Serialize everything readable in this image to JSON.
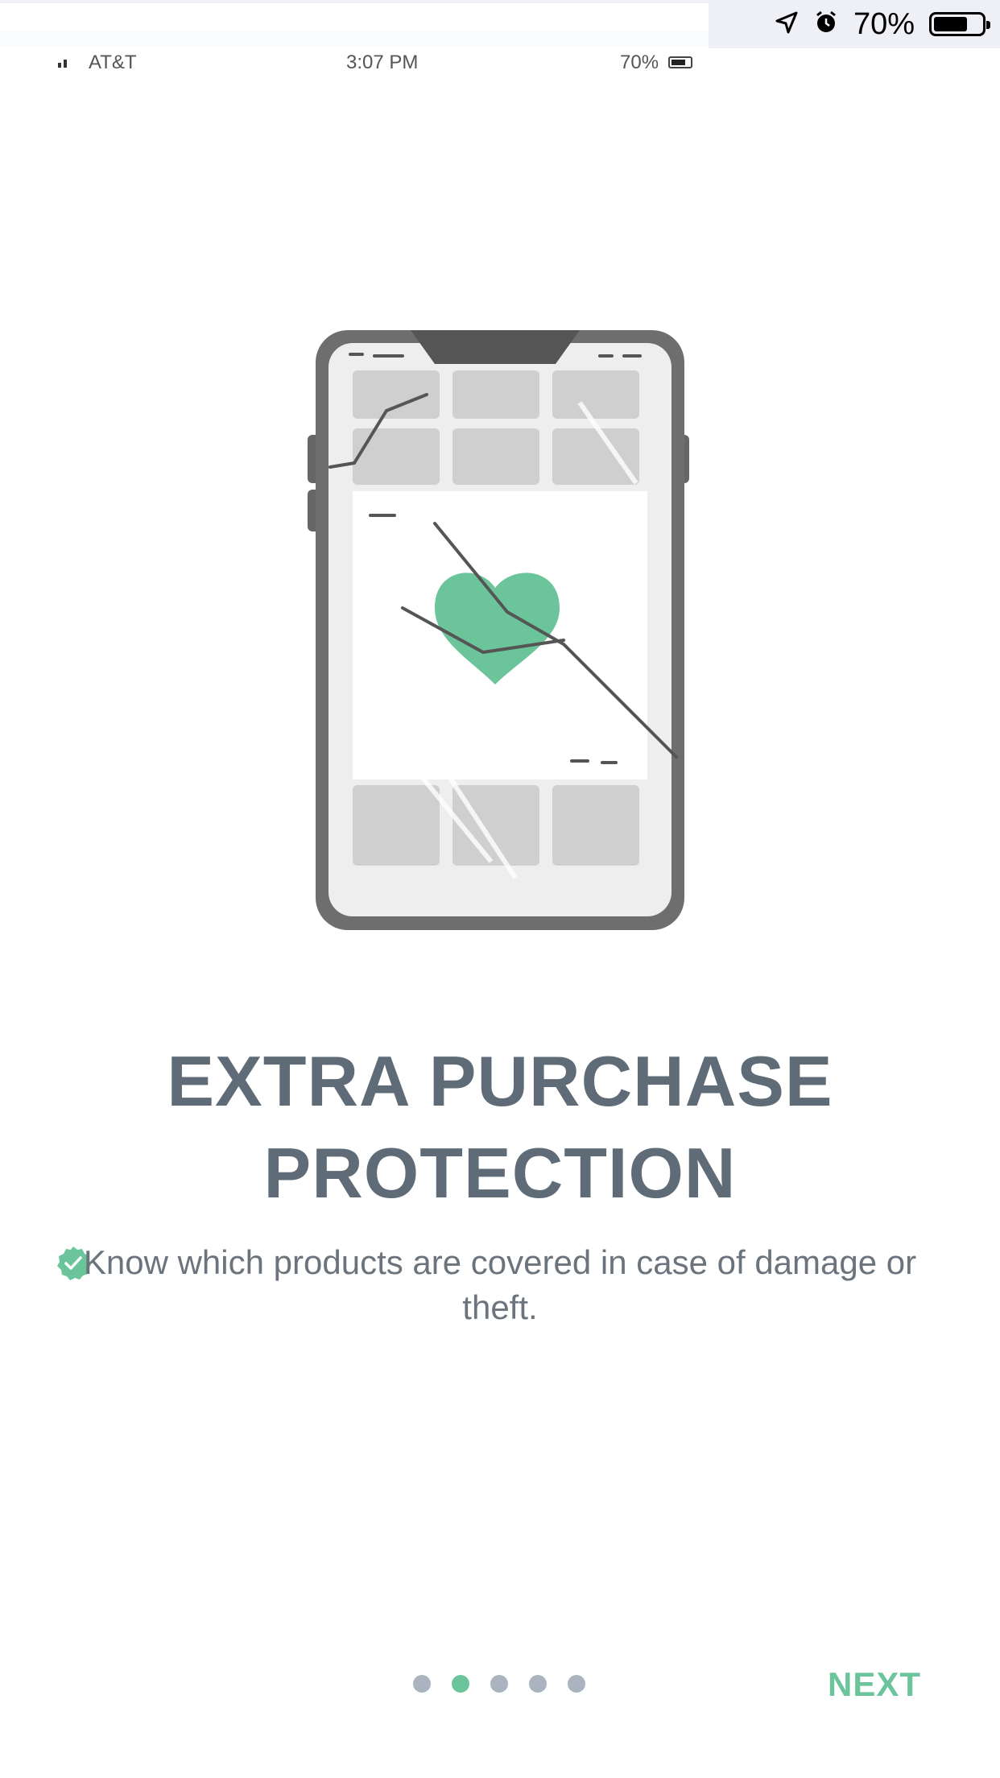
{
  "status_bar": {
    "battery_percent": "70%",
    "mini_carrier": "AT&T",
    "mini_time": "3:07 PM",
    "mini_battery_percent": "70%",
    "battery_level": 0.7
  },
  "onboarding": {
    "title_line1": "EXTRA PURCHASE",
    "title_line2": "PROTECTION",
    "description": "Know which products are covered in case of damage or theft.",
    "page_count": 5,
    "active_page_index": 1,
    "next_label": "NEXT"
  },
  "colors": {
    "accent": "#6cc49a",
    "title": "#5f6c77",
    "dot_inactive": "#a9b4c0"
  },
  "icons": {
    "check": "check-circle-icon",
    "location": "location-arrow-icon",
    "alarm": "alarm-clock-icon",
    "battery": "battery-icon",
    "illustration": "broken-phone-heart-illustration"
  }
}
